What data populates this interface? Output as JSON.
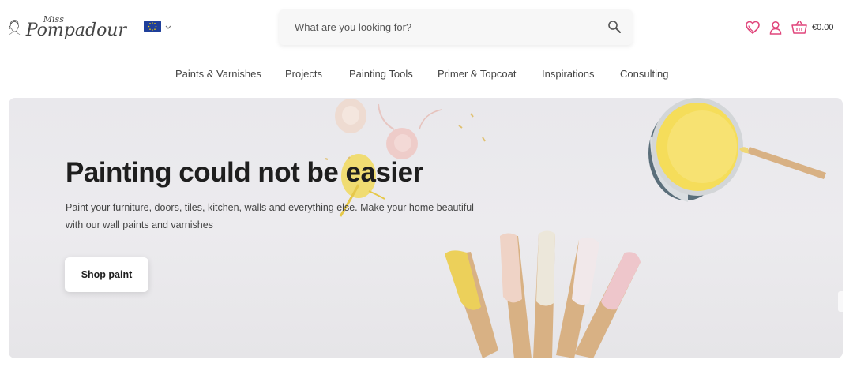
{
  "brand": {
    "logo_small": "Miss",
    "logo_big": "Pompadour"
  },
  "language": {
    "region": "EU",
    "flag_icon": "eu-flag-icon"
  },
  "search": {
    "placeholder": "What are you looking for?",
    "icon": "search-icon"
  },
  "header": {
    "wishlist_icon": "heart-icon",
    "account_icon": "user-icon",
    "basket_icon": "basket-icon",
    "cart_total": "€0.00",
    "accent_color": "#e0457b"
  },
  "nav": {
    "items": [
      {
        "label": "Paints & Varnishes"
      },
      {
        "label": "Projects"
      },
      {
        "label": "Painting Tools"
      },
      {
        "label": "Primer & Topcoat"
      },
      {
        "label": "Inspirations"
      },
      {
        "label": "Consulting"
      }
    ]
  },
  "hero": {
    "title": "Painting could not be easier",
    "subtitle": "Paint your furniture, doors, tiles, kitchen, walls and everything else. Make your home beautiful with our wall paints and varnishes",
    "button_label": "Shop paint",
    "paint_colors": [
      "#f0e06a",
      "#efd3c8",
      "#efe9dd",
      "#f4e9ea",
      "#efc8cc"
    ]
  }
}
